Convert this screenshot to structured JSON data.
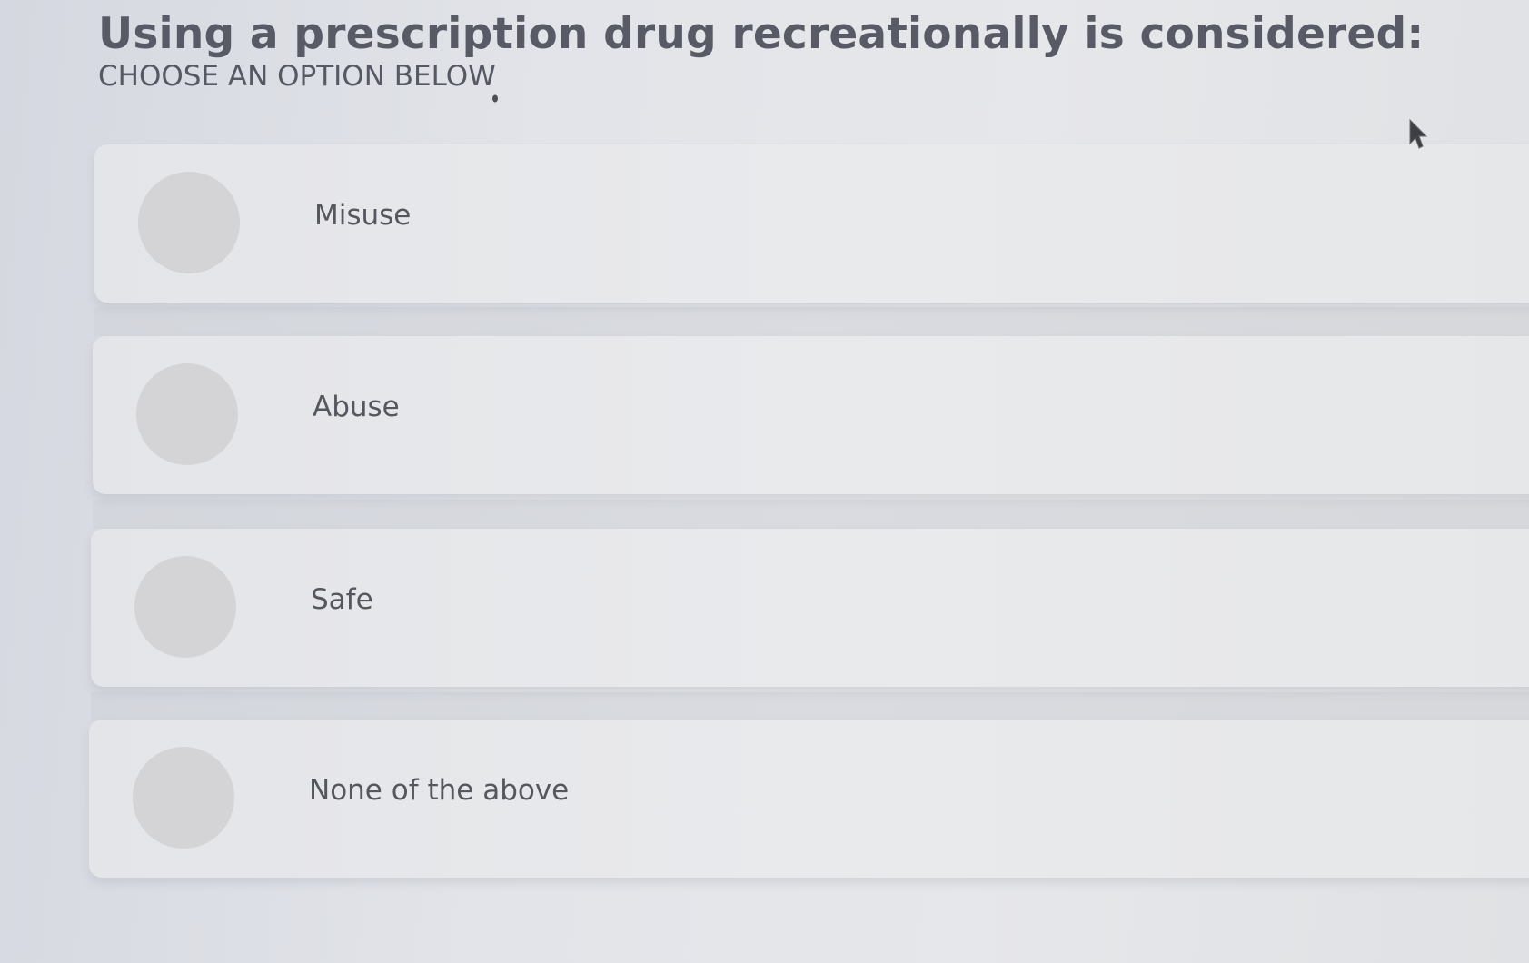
{
  "question": {
    "title": "Using a prescription drug recreationally is considered:",
    "instruction": "CHOOSE AN OPTION BELOW"
  },
  "options": [
    {
      "label": "Misuse",
      "selected": false
    },
    {
      "label": "Abuse",
      "selected": false
    },
    {
      "label": "Safe",
      "selected": false
    },
    {
      "label": "None of the above",
      "selected": false
    }
  ],
  "colors": {
    "background": "#e2e4e9",
    "card": "#e8e9ec",
    "radio": "#d4d4d6",
    "text": "#55575f",
    "title": "#585b66"
  },
  "icons": {
    "cursor": "mouse-pointer-icon"
  }
}
